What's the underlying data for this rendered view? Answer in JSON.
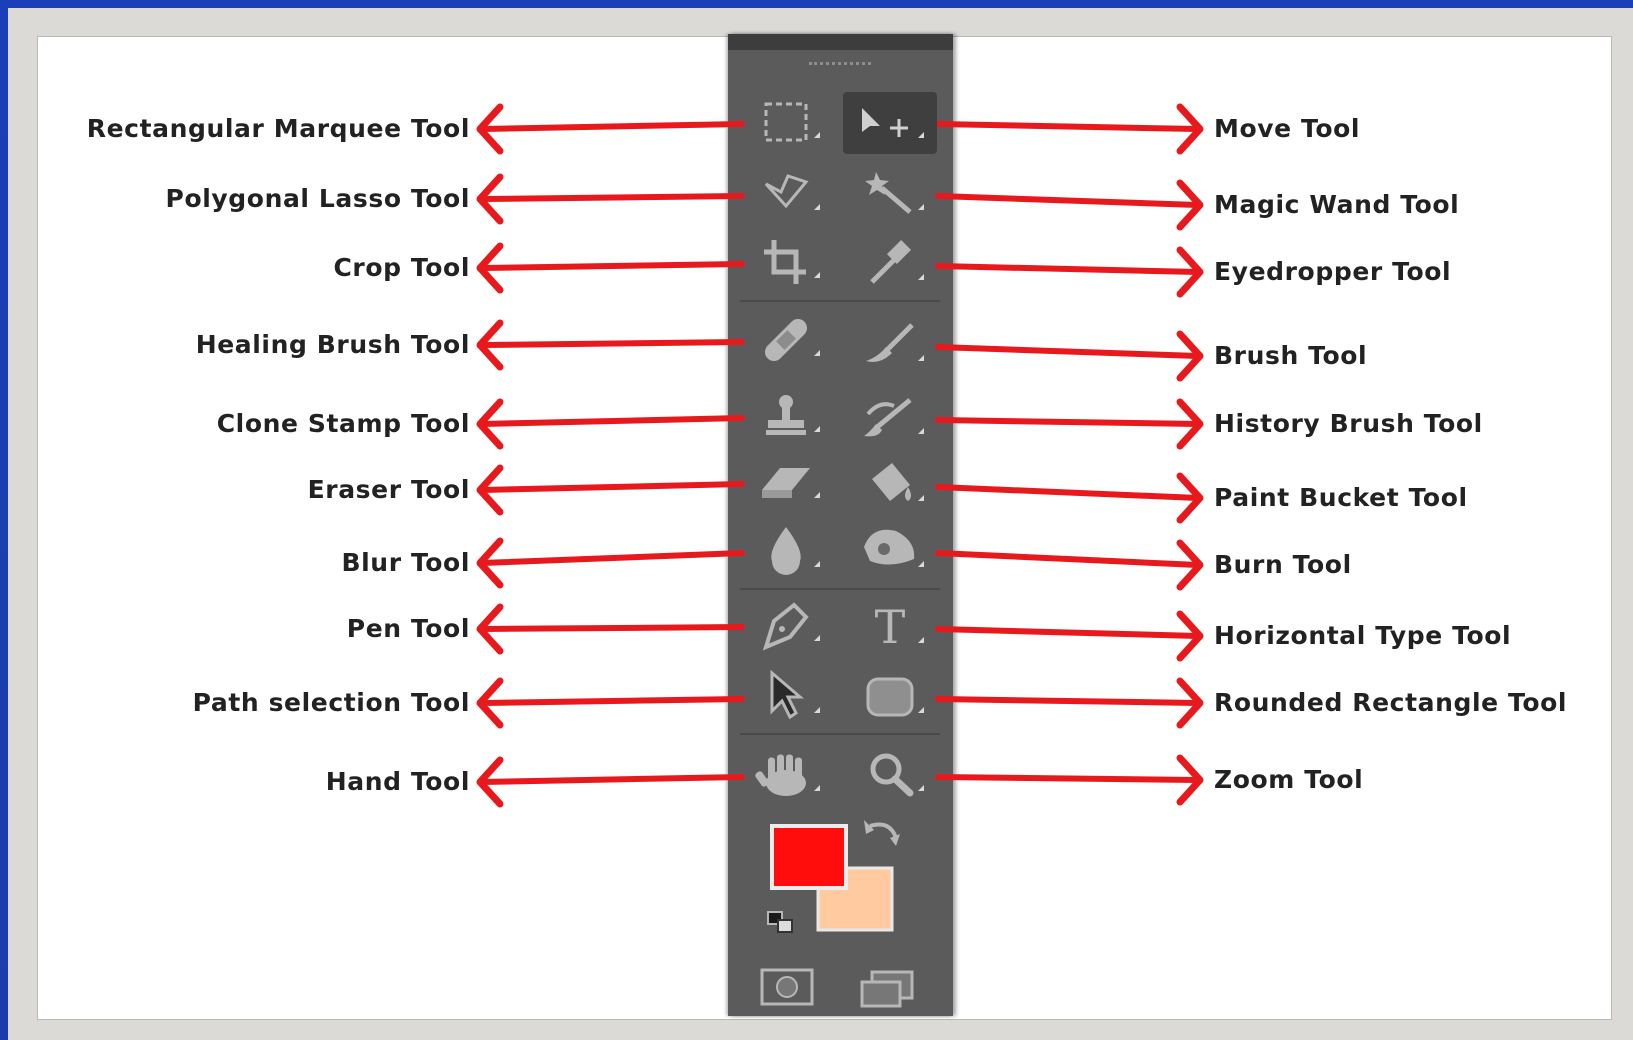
{
  "left_tools": [
    {
      "label": "Rectangular Marquee Tool",
      "icon": "rectangular-marquee-icon"
    },
    {
      "label": "Polygonal Lasso Tool",
      "icon": "polygonal-lasso-icon"
    },
    {
      "label": "Crop Tool",
      "icon": "crop-icon"
    },
    {
      "label": "Healing Brush Tool",
      "icon": "healing-brush-icon"
    },
    {
      "label": "Clone Stamp Tool",
      "icon": "clone-stamp-icon"
    },
    {
      "label": "Eraser Tool",
      "icon": "eraser-icon"
    },
    {
      "label": "Blur Tool",
      "icon": "blur-drop-icon"
    },
    {
      "label": "Pen Tool",
      "icon": "pen-nib-icon"
    },
    {
      "label": "Path selection Tool",
      "icon": "path-selection-arrow-icon"
    },
    {
      "label": "Hand Tool",
      "icon": "hand-icon"
    }
  ],
  "right_tools": [
    {
      "label": "Move Tool",
      "icon": "move-icon"
    },
    {
      "label": "Magic Wand Tool",
      "icon": "magic-wand-icon"
    },
    {
      "label": "Eyedropper Tool",
      "icon": "eyedropper-icon"
    },
    {
      "label": "Brush Tool",
      "icon": "brush-icon"
    },
    {
      "label": "History Brush Tool",
      "icon": "history-brush-icon"
    },
    {
      "label": "Paint Bucket Tool",
      "icon": "paint-bucket-icon"
    },
    {
      "label": "Burn Tool",
      "icon": "burn-hand-icon"
    },
    {
      "label": "Horizontal Type Tool",
      "icon": "type-t-icon",
      "glyph": "T"
    },
    {
      "label": "Rounded Rectangle Tool",
      "icon": "rounded-rectangle-icon"
    },
    {
      "label": "Zoom Tool",
      "icon": "magnifier-icon"
    }
  ],
  "colors": {
    "foreground": "#ff0d0d",
    "background": "#ffcaa0",
    "arrow": "#e8191c",
    "toolbar": "#5b5b5b"
  },
  "footer_icons": [
    "quick-mask-icon",
    "screen-mode-icon",
    "swap-colors-icon",
    "default-colors-icon"
  ]
}
